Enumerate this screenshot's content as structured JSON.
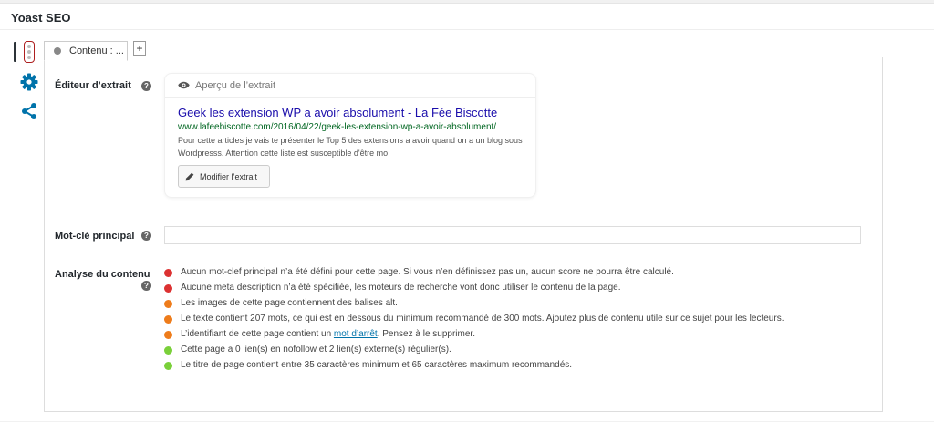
{
  "metabox": {
    "title": "Yoast SEO"
  },
  "tabs": {
    "content_label": "Contenu : ...",
    "add_label": "+"
  },
  "snippet": {
    "label": "Éditeur d’extrait",
    "preview_label": "Aperçu de l’extrait",
    "title": "Geek les extension WP a avoir absolument - La Fée Biscotte",
    "url": "www.lafeebiscotte.com/2016/04/22/geek-les-extension-wp-a-avoir-absolument/",
    "description": "Pour cette articles je vais te présenter le Top 5 des extensions a avoir quand on a un blog sous Wordpresss. Attention cette liste est susceptible d'être mo",
    "edit_button": "Modifier l’extrait"
  },
  "keyword": {
    "label": "Mot-clé principal",
    "value": ""
  },
  "analysis": {
    "label": "Analyse du contenu",
    "colors": {
      "red": "#dc3232",
      "orange": "#ee7c1b",
      "green": "#7ad03a"
    },
    "items": [
      {
        "status": "red",
        "text": "Aucun mot-clef principal n’a été défini pour cette page. Si vous n’en définissez pas un, aucun score ne pourra être calculé."
      },
      {
        "status": "red",
        "text": "Aucune meta description n’a été spécifiée, les moteurs de recherche vont donc utiliser le contenu de la page."
      },
      {
        "status": "orange",
        "text": "Les images de cette page contiennent des balises alt."
      },
      {
        "status": "orange",
        "text": "Le texte contient 207 mots, ce qui est en dessous du minimum recommandé de 300 mots. Ajoutez plus de contenu utile sur ce sujet pour les lecteurs."
      },
      {
        "status": "orange",
        "before": "L’identifiant de cette page contient un ",
        "link": "mot d’arrêt",
        "after": ". Pensez à le supprimer."
      },
      {
        "status": "green",
        "text": "Cette page a 0 lien(s) en nofollow et 2 lien(s) externe(s) régulier(s)."
      },
      {
        "status": "green",
        "text": "Le titre de page contient entre 35 caractères minimum et 65 caractères maximum recommandés."
      }
    ]
  }
}
